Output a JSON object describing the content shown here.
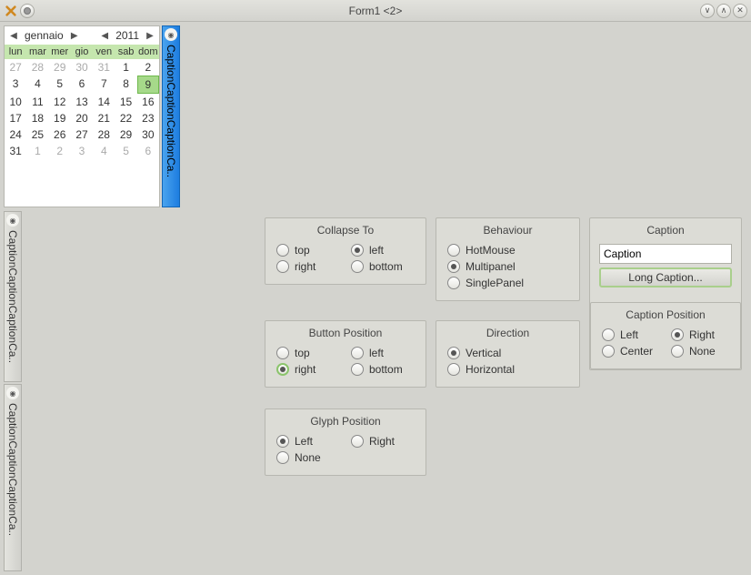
{
  "window": {
    "title": "Form1 <2>"
  },
  "calendar": {
    "month": "gennaio",
    "year": "2011",
    "weekdays": [
      "lun",
      "mar",
      "mer",
      "gio",
      "ven",
      "sab",
      "dom"
    ],
    "rows": [
      [
        {
          "v": "27",
          "d": 1
        },
        {
          "v": "28",
          "d": 1
        },
        {
          "v": "29",
          "d": 1
        },
        {
          "v": "30",
          "d": 1
        },
        {
          "v": "31",
          "d": 1
        },
        {
          "v": "1",
          "d": 0
        },
        {
          "v": "2",
          "d": 0
        }
      ],
      [
        {
          "v": "3",
          "d": 0
        },
        {
          "v": "4",
          "d": 0
        },
        {
          "v": "5",
          "d": 0
        },
        {
          "v": "6",
          "d": 0
        },
        {
          "v": "7",
          "d": 0
        },
        {
          "v": "8",
          "d": 0
        },
        {
          "v": "9",
          "d": 0,
          "sel": 1
        }
      ],
      [
        {
          "v": "10",
          "d": 0
        },
        {
          "v": "11",
          "d": 0
        },
        {
          "v": "12",
          "d": 0
        },
        {
          "v": "13",
          "d": 0
        },
        {
          "v": "14",
          "d": 0
        },
        {
          "v": "15",
          "d": 0
        },
        {
          "v": "16",
          "d": 0
        }
      ],
      [
        {
          "v": "17",
          "d": 0
        },
        {
          "v": "18",
          "d": 0
        },
        {
          "v": "19",
          "d": 0
        },
        {
          "v": "20",
          "d": 0
        },
        {
          "v": "21",
          "d": 0
        },
        {
          "v": "22",
          "d": 0
        },
        {
          "v": "23",
          "d": 0
        }
      ],
      [
        {
          "v": "24",
          "d": 0
        },
        {
          "v": "25",
          "d": 0
        },
        {
          "v": "26",
          "d": 0
        },
        {
          "v": "27",
          "d": 0
        },
        {
          "v": "28",
          "d": 0
        },
        {
          "v": "29",
          "d": 0
        },
        {
          "v": "30",
          "d": 0
        }
      ],
      [
        {
          "v": "31",
          "d": 0
        },
        {
          "v": "1",
          "d": 1
        },
        {
          "v": "2",
          "d": 1
        },
        {
          "v": "3",
          "d": 1
        },
        {
          "v": "4",
          "d": 1
        },
        {
          "v": "5",
          "d": 1
        },
        {
          "v": "6",
          "d": 1
        }
      ]
    ]
  },
  "caption_bar": "CaptionCaptionCaptionCa..",
  "groups": {
    "collapse": {
      "title": "Collapse To",
      "opts": [
        {
          "label": "top",
          "on": 0
        },
        {
          "label": "left",
          "on": 1
        },
        {
          "label": "right",
          "on": 0
        },
        {
          "label": "bottom",
          "on": 0
        }
      ]
    },
    "buttonpos": {
      "title": "Button Position",
      "opts": [
        {
          "label": "top",
          "on": 0
        },
        {
          "label": "left",
          "on": 0
        },
        {
          "label": "right",
          "on": 1,
          "green": 1
        },
        {
          "label": "bottom",
          "on": 0
        }
      ]
    },
    "glyph": {
      "title": "Glyph Position",
      "opts": [
        {
          "label": "Left",
          "on": 1
        },
        {
          "label": "Right",
          "on": 0
        },
        {
          "label": "None",
          "on": 0
        }
      ]
    },
    "behaviour": {
      "title": "Behaviour",
      "opts": [
        {
          "label": "HotMouse",
          "on": 0
        },
        {
          "label": "Multipanel",
          "on": 1
        },
        {
          "label": "SinglePanel",
          "on": 0
        }
      ]
    },
    "direction": {
      "title": "Direction",
      "opts": [
        {
          "label": "Vertical",
          "on": 1
        },
        {
          "label": "Horizontal",
          "on": 0
        }
      ]
    },
    "caption": {
      "title": "Caption",
      "value": "Caption",
      "button": "Long Caption...",
      "pos_title": "Caption Position",
      "pos_opts": [
        {
          "label": "Left",
          "on": 0
        },
        {
          "label": "Right",
          "on": 1
        },
        {
          "label": "Center",
          "on": 0
        },
        {
          "label": "None",
          "on": 0
        }
      ]
    }
  }
}
